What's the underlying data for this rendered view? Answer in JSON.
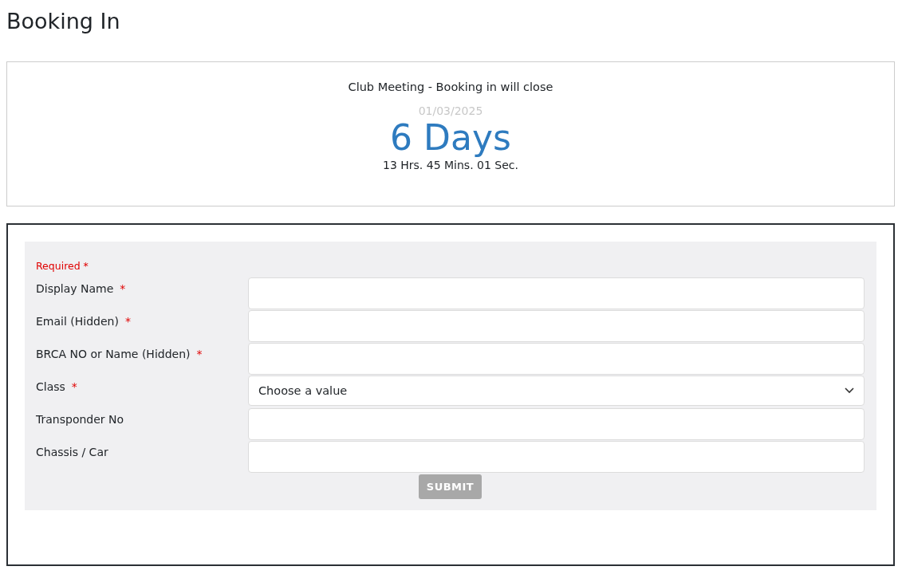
{
  "page_title": "Booking In",
  "countdown": {
    "event": "Club Meeting - Booking in will close",
    "date": "01/03/2025",
    "days": "6 Days",
    "remaining": "13 Hrs. 45 Mins. 01 Sec."
  },
  "form": {
    "required_note": "Required *",
    "fields": [
      {
        "kind": "text",
        "label": "Display Name",
        "mark": "*"
      },
      {
        "kind": "text",
        "label": "Email (Hidden)",
        "mark": "*"
      },
      {
        "kind": "text",
        "label": "BRCA NO or Name (Hidden)",
        "mark": "*"
      },
      {
        "kind": "select",
        "label": "Class",
        "mark": "*",
        "value": "Choose a value"
      },
      {
        "kind": "text",
        "label": "Transponder No"
      },
      {
        "kind": "text",
        "label": "Chassis / Car"
      }
    ],
    "submit": {
      "label": "SUBMIT",
      "disabled": true
    }
  }
}
